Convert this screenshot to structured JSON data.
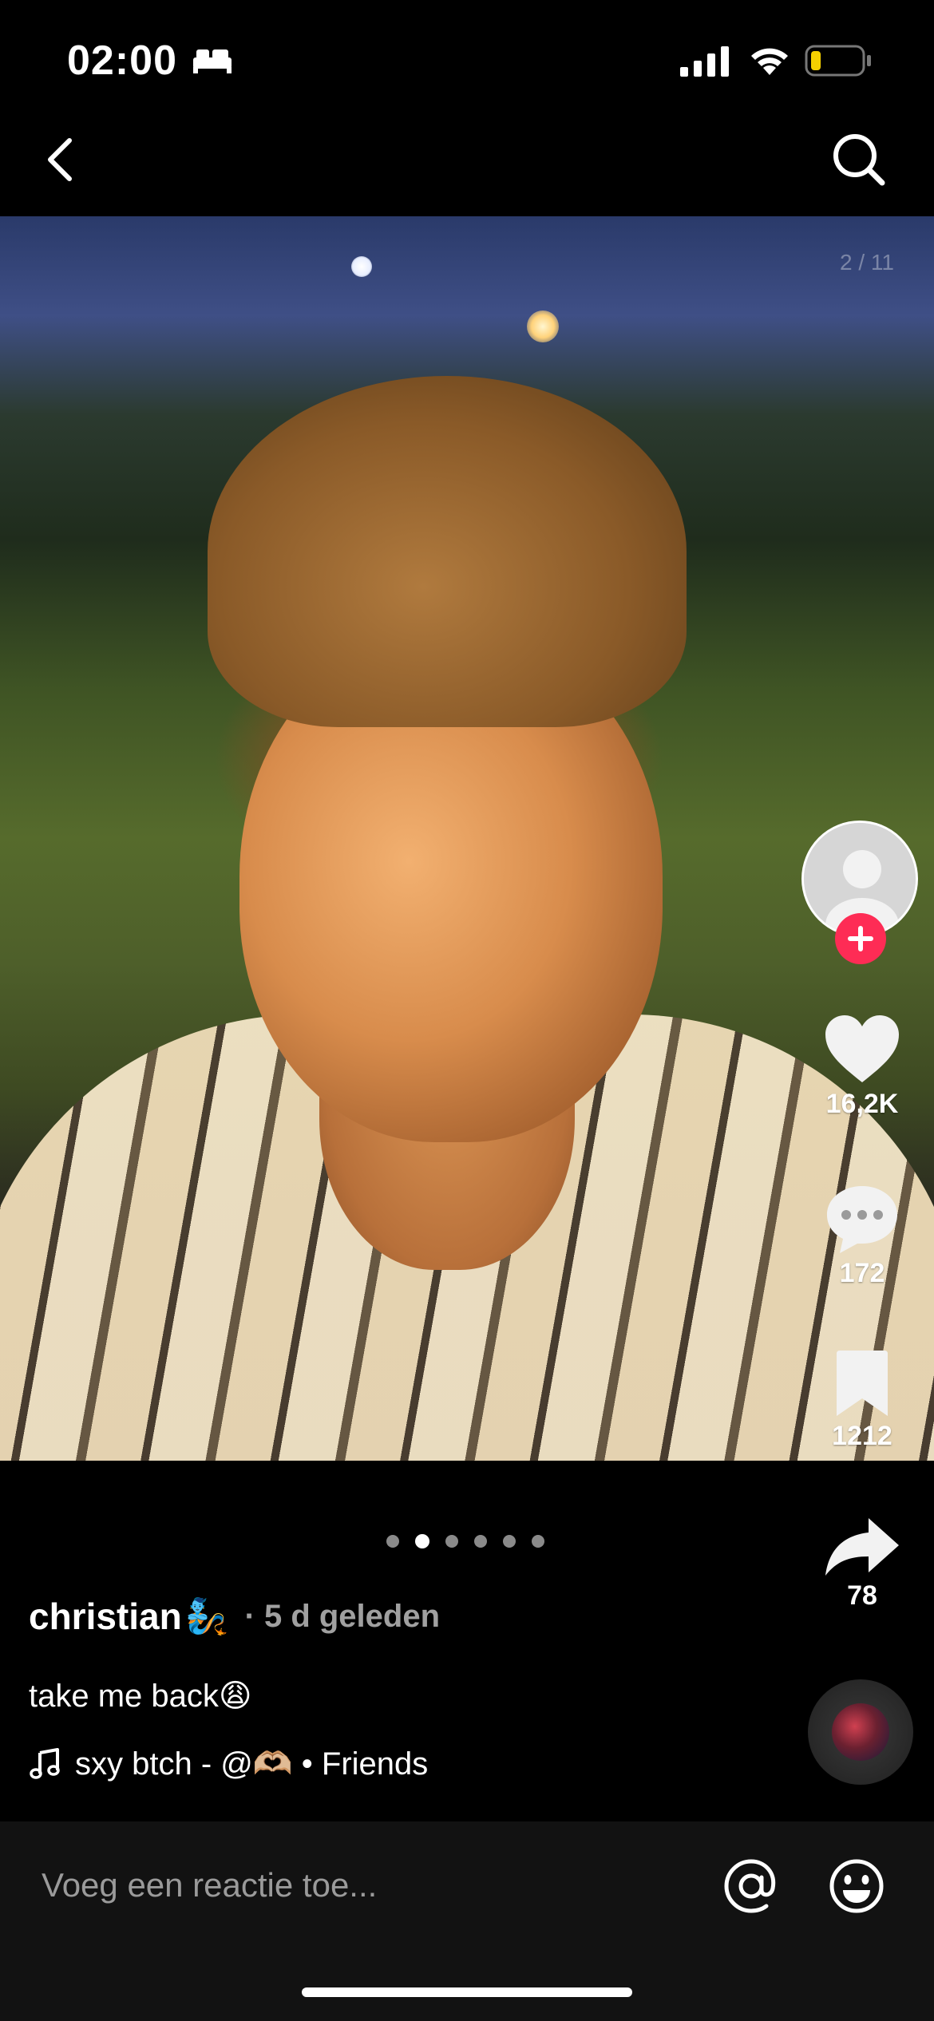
{
  "status_bar": {
    "time": "02:00",
    "icons": [
      "bed-icon",
      "cellular-signal-icon",
      "wifi-icon",
      "battery-low-icon"
    ],
    "battery_color": "#f5d000"
  },
  "nav": {
    "back_icon": "chevron-left-icon",
    "search_icon": "search-icon"
  },
  "post": {
    "photo_counter": "2 / 11",
    "pager": {
      "count": 6,
      "active_index": 1
    },
    "author": "christian",
    "author_emoji": "🧞",
    "time_ago": "· 5 d geleden",
    "caption": "take me back😩",
    "music": "sxy btch - @🫶🏼 • Friends"
  },
  "actions": {
    "likes": "16,2K",
    "comments": "172",
    "saves": "1212",
    "shares": "78",
    "accent_color": "#fe2c55"
  },
  "comment_bar": {
    "placeholder": "Voeg een reactie toe..."
  }
}
